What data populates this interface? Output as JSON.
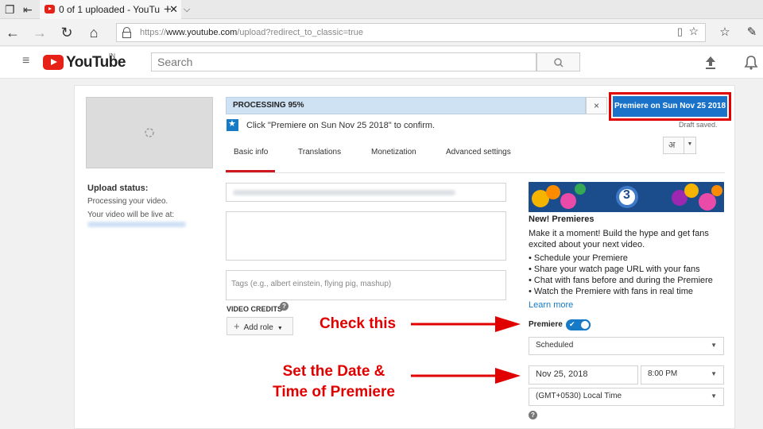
{
  "browser": {
    "tab_title": "0 of 1 uploaded - YouTu",
    "tab_close": "✕",
    "new_tab": "+",
    "tab_menu": "⌵",
    "url_prefix": "https://",
    "url_host": "www.youtube.com",
    "url_path": "/upload?redirect_to_classic=true"
  },
  "youtube": {
    "logo": "YouTube",
    "region": "IN",
    "search_placeholder": "Search"
  },
  "upload": {
    "status_title": "Upload status:",
    "status_text": "Processing your video.",
    "live_at": "Your video will be live at:",
    "progress_label": "PROCESSING 95%",
    "progress": 0.95,
    "close": "×",
    "premiere_button": "Premiere on Sun Nov 25 2018",
    "confirm_text": "Click \"Premiere on Sun Nov 25 2018\" to confirm.",
    "draft_saved": "Draft saved.",
    "lang_glyph": "अ"
  },
  "tabs": [
    {
      "label": "Basic info",
      "active": true
    },
    {
      "label": "Translations"
    },
    {
      "label": "Monetization"
    },
    {
      "label": "Advanced settings"
    }
  ],
  "form": {
    "tags_placeholder": "Tags (e.g., albert einstein, flying pig, mashup)",
    "video_credits": "VIDEO CREDITS",
    "add_role": "Add role"
  },
  "premieres": {
    "title": "New! Premieres",
    "description": "Make it a moment! Build the hype and get fans excited about your next video.",
    "bullets": [
      "• Schedule your Premiere",
      "• Share your watch page URL with your fans",
      "• Chat with fans before and during the Premiere",
      "• Watch the Premiere with fans in real time"
    ],
    "learn_more": "Learn more",
    "premiere_label": "Premiere",
    "premiere_enabled": true,
    "visibility": "Scheduled",
    "date": "Nov 25, 2018",
    "time": "8:00 PM",
    "timezone": "(GMT+0530) Local Time",
    "countdown": "3"
  },
  "annotations": {
    "check_this": "Check this",
    "set_date_line1": "Set the Date &",
    "set_date_line2": "Time of Premiere",
    "color": "#e00000"
  },
  "colors": {
    "accent_blue": "#1a73c9",
    "youtube_red": "#e62117",
    "progress_bg": "#cfe2f3"
  }
}
